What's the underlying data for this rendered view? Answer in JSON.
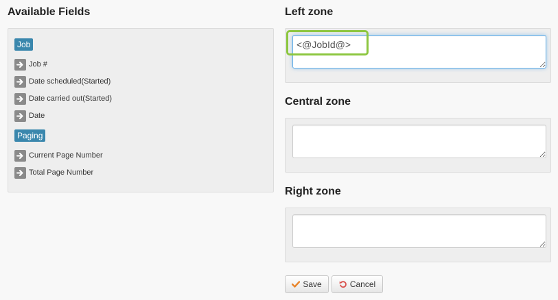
{
  "available_fields": {
    "title": "Available Fields",
    "groups": [
      {
        "label": "Job",
        "fields": [
          "Job #",
          "Date scheduled(Started)",
          "Date carried out(Started)",
          "Date"
        ]
      },
      {
        "label": "Paging",
        "fields": [
          "Current Page Number",
          "Total Page Number"
        ]
      }
    ],
    "arrow_icon": "arrow-right-icon"
  },
  "zones": {
    "left": {
      "title": "Left zone",
      "value": "<@JobId@>"
    },
    "central": {
      "title": "Central zone",
      "value": ""
    },
    "right": {
      "title": "Right zone",
      "value": ""
    }
  },
  "actions": {
    "save_label": "Save",
    "save_icon": "check-icon",
    "cancel_label": "Cancel",
    "cancel_icon": "undo-icon"
  },
  "colors": {
    "group_badge": "#3a87ad",
    "highlight_ring": "#8cc63f",
    "check_icon": "#e8852c",
    "undo_icon": "#d9534f"
  }
}
